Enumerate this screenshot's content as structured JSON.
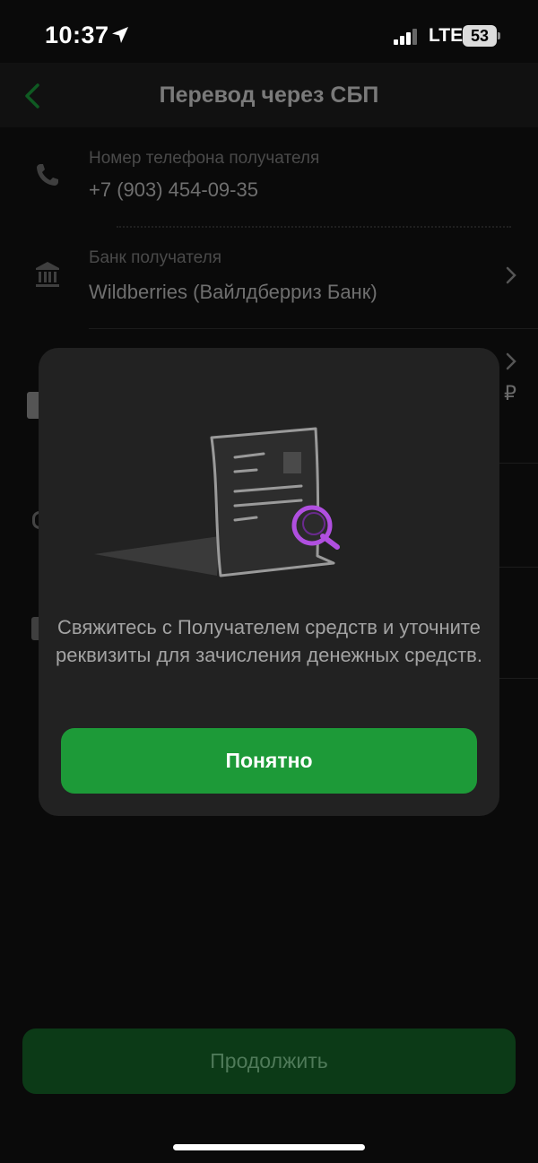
{
  "status_bar": {
    "time": "10:37",
    "network": "LTE",
    "battery": "53"
  },
  "header": {
    "title": "Перевод через СБП"
  },
  "form": {
    "phone_label": "Номер телефона получателя",
    "phone_value": "+7 (903) 454-09-35",
    "bank_label": "Банк получателя",
    "bank_value": "Wildberries (Вайлдберриз Банк)",
    "currency": "₽"
  },
  "modal": {
    "message": "Свяжитесь с Получателем средств и уточните реквизиты для зачисления денежных средств.",
    "ok_label": "Понятно",
    "accent_color": "#1d9a38"
  },
  "footer": {
    "continue_label": "Продолжить"
  }
}
